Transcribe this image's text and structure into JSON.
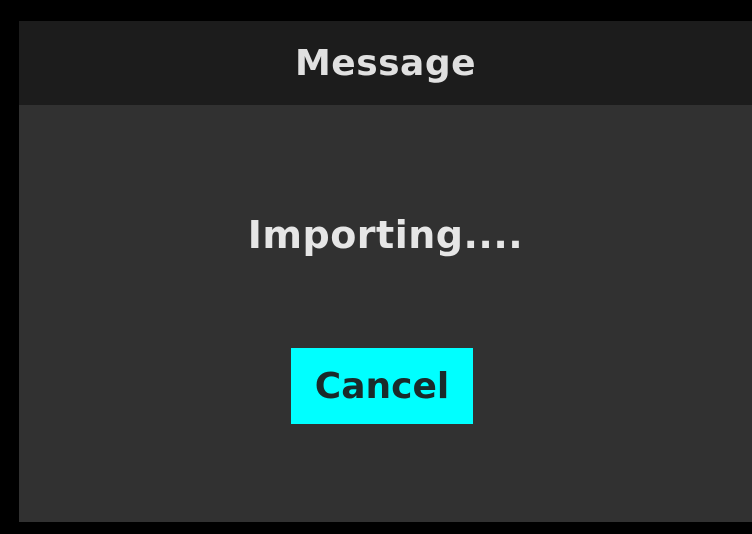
{
  "dialog": {
    "title": "Message",
    "message": "Importing....",
    "cancel_label": "Cancel"
  },
  "colors": {
    "background": "#000000",
    "dialog_body": "#313131",
    "title_bar": "#1c1c1c",
    "text": "#e6e6e6",
    "button_accent": "#00ffff"
  }
}
